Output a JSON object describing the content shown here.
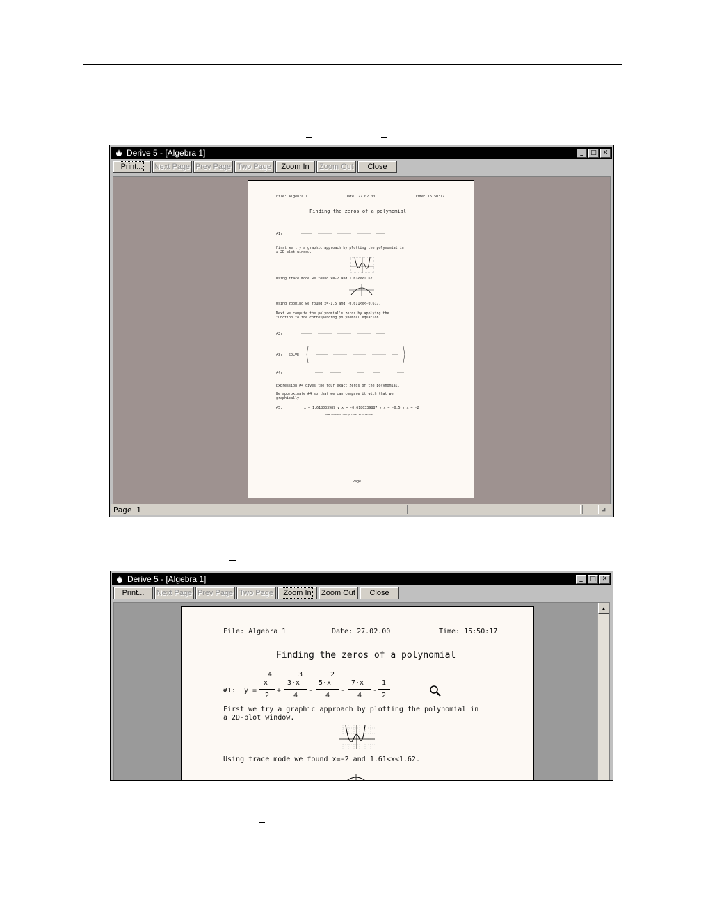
{
  "window_title": "Derive 5 - [Algebra 1]",
  "toolbar": {
    "print": "Print...",
    "next_page": "Next Page",
    "prev_page": "Prev Page",
    "two_page": "Two Page",
    "zoom_in": "Zoom In",
    "zoom_out": "Zoom Out",
    "close": "Close"
  },
  "controls": {
    "minimize": "_",
    "maximize": "□",
    "close": "✕",
    "scroll_up": "▲"
  },
  "status": {
    "page_label": "Page 1"
  },
  "doc": {
    "file": "File: Algebra 1",
    "date": "Date: 27.02.00",
    "time": "Time: 15:50:17",
    "title": "Finding the zeros of a polynomial",
    "eq1_label": "#1:",
    "eq1_lhs": "y =",
    "eq1_num": [
      "x",
      "3·x",
      "5·x",
      "7·x",
      "1"
    ],
    "eq1_pow": [
      "4",
      "3",
      "2",
      "",
      ""
    ],
    "eq1_den": [
      "2",
      "4",
      "4",
      "4",
      "2"
    ],
    "eq1_ops": [
      "+",
      "-",
      "-",
      "-"
    ],
    "para1_line1": "First we try a graphic approach by plotting the polynomial in",
    "para1_line2": "a 2D-plot window.",
    "trace": "Using trace mode we found x=-2 and 1.61<x<1.62.",
    "zoom": "Using zooming we found x=-1.5 and -0.611<x<-0.617.",
    "next1": "Next we compute the polynomial's zeros by applying the",
    "next2": "function to the corresponding polynomial equation.",
    "eq2_label": "#2:",
    "eq3_label": "#3:",
    "eq4_label": "#4:",
    "eq3_solve": "SOLVE",
    "expr4": "Expression #4 gives the four exact zeros of the polynomial.",
    "approx1": "We approximate #4 so that we can compare it with that we",
    "approx2": "graphically.",
    "eq5_label": "#5:",
    "eq5": "x = 1.618033989 ∨ x = -0.6180339887 ∨ x = -0.5 ∨ x = -2",
    "footnote": "Some document text printed with Derive",
    "page_footer": "Page: 1"
  }
}
